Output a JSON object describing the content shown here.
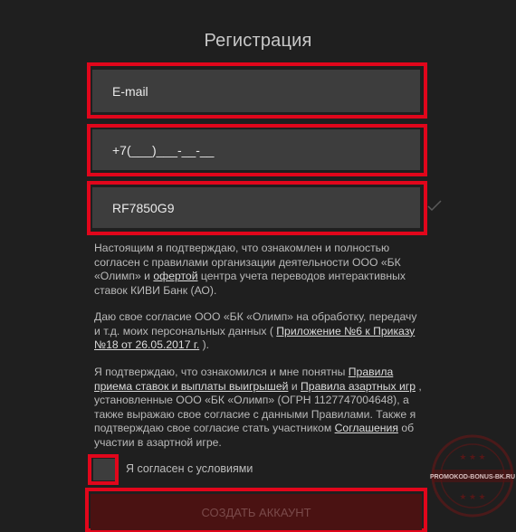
{
  "title": "Регистрация",
  "fields": {
    "email_placeholder": "E-mail",
    "phone_value": "+7(___)___-__-__",
    "promo_value": "RF7850G9"
  },
  "consent": {
    "p1_pre": "Настоящим я подтверждаю, что ознакомлен и полностью согласен с правилами организации деятельности ООО «БК «Олимп» и ",
    "p1_link": "офертой",
    "p1_post": " центра учета переводов интерактивных ставок КИВИ Банк (АО).",
    "p2_pre": "Даю свое согласие ООО «БК «Олимп» на обработку, передачу и т.д. моих персональных данных ( ",
    "p2_link": "Приложение №6 к Приказу №18 от 26.05.2017 г.",
    "p2_post": " ).",
    "p3_pre": "Я подтверждаю, что ознакомился и мне понятны ",
    "p3_link1": "Правила приема ставок и выплаты выигрышей",
    "p3_mid1": " и ",
    "p3_link2": "Правила азартных игр",
    "p3_mid2": " , установленные ООО «БК «Олимп» (ОГРН 1127747004648), а также выражаю свое согласие с данными Правилами. Также я подтверждаю свое согласие стать участником ",
    "p3_link3": "Соглашения",
    "p3_post": " об участии в азартной игре."
  },
  "agree_label": "Я согласен с условиями",
  "submit_label": "СОЗДАТЬ АККАУНТ",
  "watermark_text": "PROMOKOD-BONUS-BK.RU",
  "colors": {
    "highlight": "#e1061b",
    "field_bg": "#3d3d3d",
    "page_bg": "#1f1f1f",
    "submit_bg": "#4a1212"
  }
}
